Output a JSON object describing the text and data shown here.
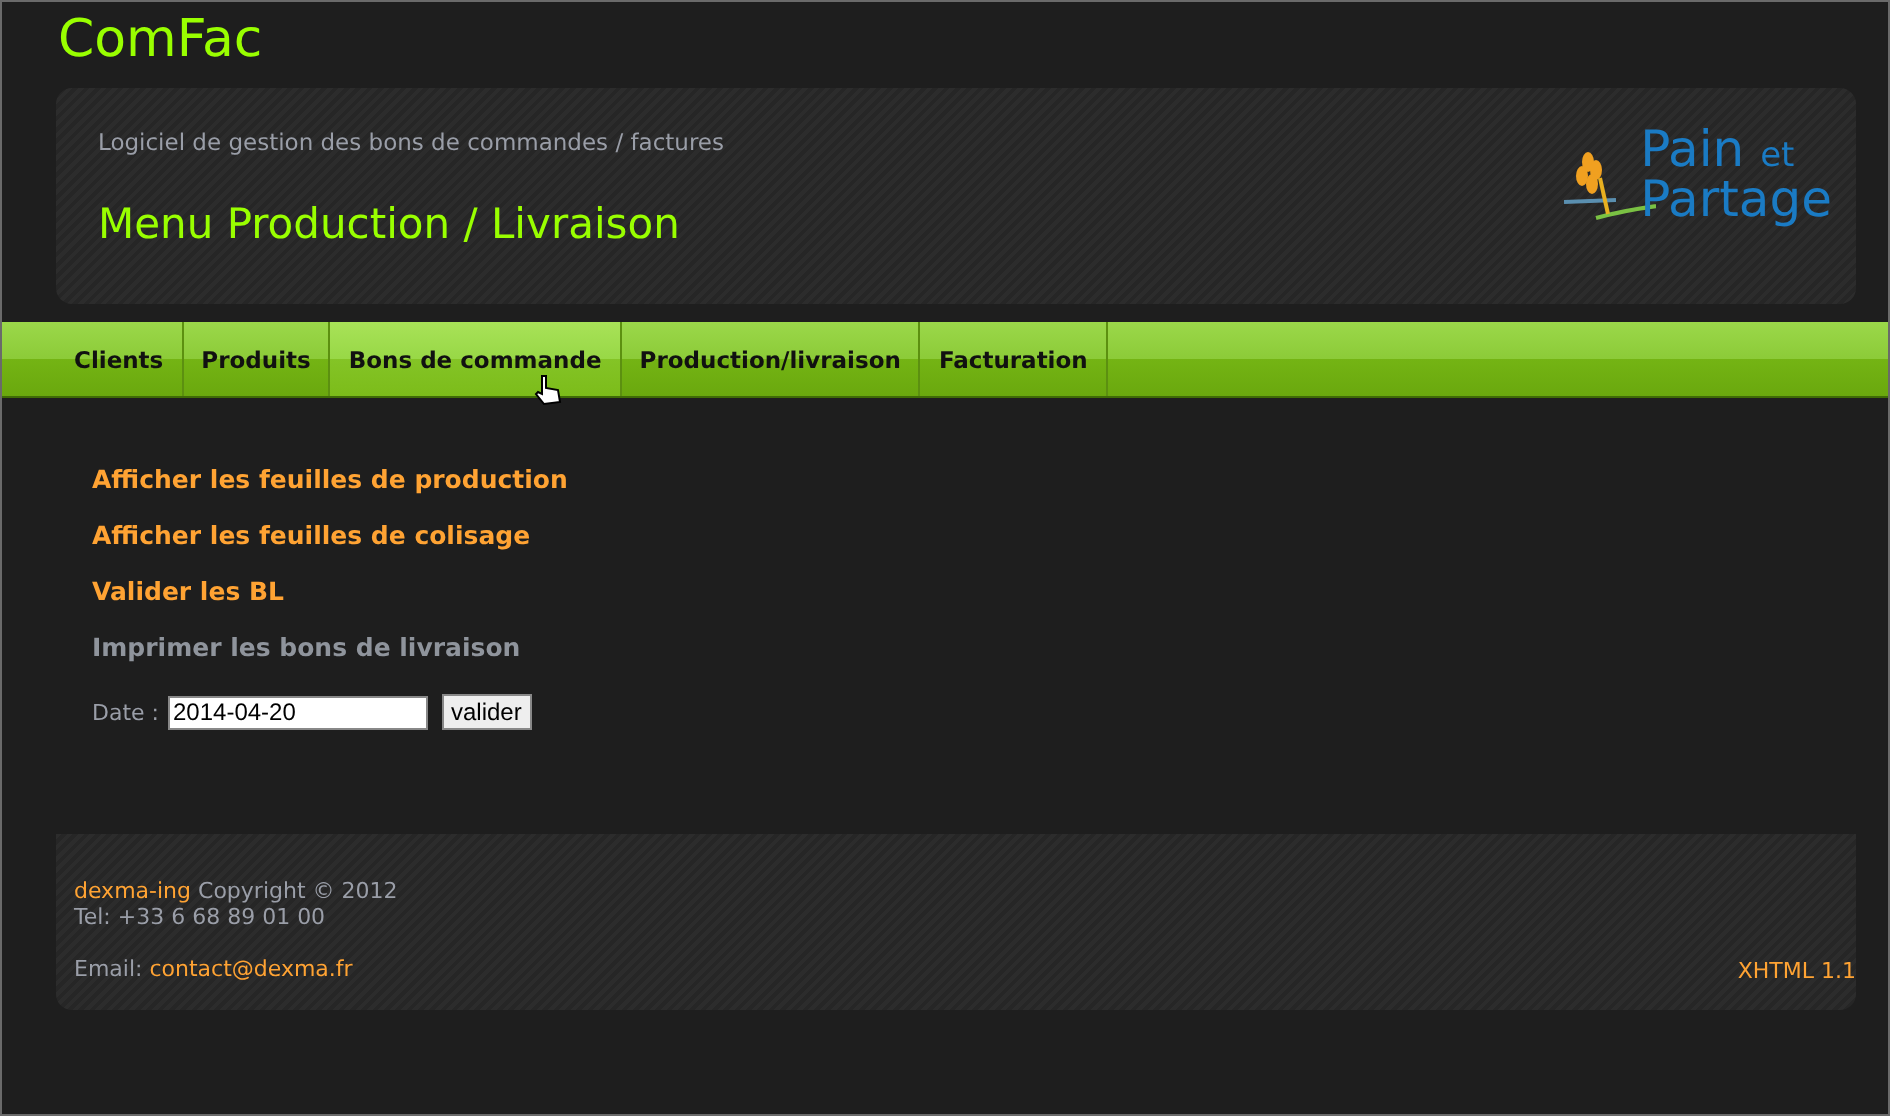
{
  "app_title": "ComFac",
  "header": {
    "subtitle": "Logiciel de gestion des bons de commandes / factures",
    "page_title": "Menu Production / Livraison",
    "logo": {
      "line_1": "Pain",
      "line_1_small": "et",
      "line_2": "Partage"
    }
  },
  "nav": [
    {
      "label": "Clients",
      "hovered": false
    },
    {
      "label": "Produits",
      "hovered": false
    },
    {
      "label": "Bons de commande",
      "hovered": true
    },
    {
      "label": "Production/livraison",
      "hovered": false
    },
    {
      "label": "Facturation",
      "hovered": false
    }
  ],
  "links": [
    {
      "label": "Afficher les feuilles de production",
      "disabled": false
    },
    {
      "label": "Afficher les feuilles de colisage",
      "disabled": false
    },
    {
      "label": "Valider les BL",
      "disabled": false
    },
    {
      "label": "Imprimer les bons de livraison",
      "disabled": true
    }
  ],
  "date_form": {
    "label": "Date :",
    "value": "2014-04-20",
    "button": "valider"
  },
  "footer": {
    "company": "dexma-ing",
    "copyright": "Copyright © 2012",
    "phone": "Tel: +33 6 68 89 01 00",
    "email_label": "Email:",
    "email": "contact@dexma.fr",
    "validator": "XHTML 1.1"
  }
}
